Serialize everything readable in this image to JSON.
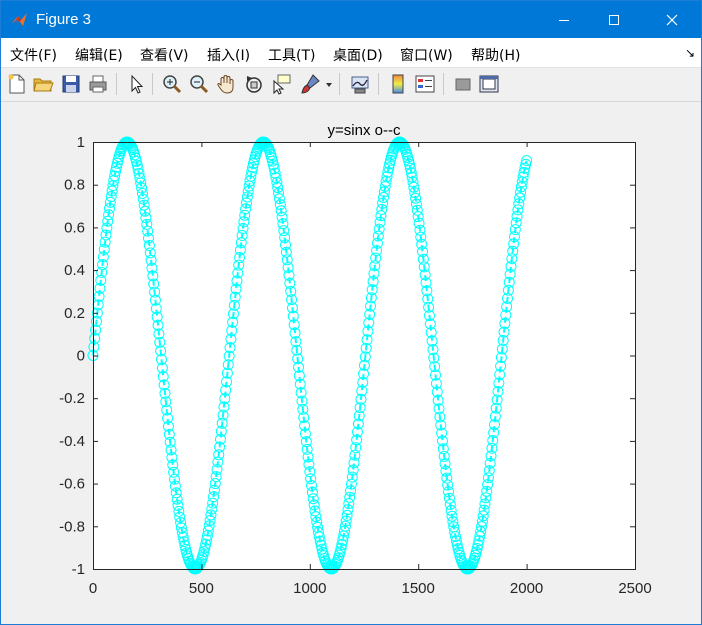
{
  "window": {
    "title": "Figure 3",
    "controls": [
      "minimize",
      "maximize",
      "close"
    ]
  },
  "menubar": {
    "items": [
      {
        "label": "文件(F)"
      },
      {
        "label": "编辑(E)"
      },
      {
        "label": "查看(V)"
      },
      {
        "label": "插入(I)"
      },
      {
        "label": "工具(T)"
      },
      {
        "label": "桌面(D)"
      },
      {
        "label": "窗口(W)"
      },
      {
        "label": "帮助(H)"
      }
    ]
  },
  "toolbar": {
    "buttons": [
      "new-figure-icon",
      "open-file-icon",
      "save-icon",
      "print-icon",
      "edit-plot-icon",
      "zoom-in-icon",
      "zoom-out-icon",
      "pan-icon",
      "rotate-3d-icon",
      "data-cursor-icon",
      "brush-icon",
      "link-plot-icon",
      "colorbar-icon",
      "legend-icon",
      "hide-plot-tools-icon",
      "show-plot-tools-icon"
    ]
  },
  "colors": {
    "titlebar": "#0078d7",
    "series": "#00ffff",
    "plot_background": "#ffffff",
    "figure_background": "#f0f0f0"
  },
  "chart_data": {
    "type": "line",
    "title": "y=sinx o--c",
    "xlabel": "",
    "ylabel": "",
    "xlim": [
      0,
      2500
    ],
    "ylim": [
      -1,
      1
    ],
    "x_ticks": [
      "0",
      "500",
      "1000",
      "1500",
      "2000",
      "2500"
    ],
    "y_ticks": [
      "-1",
      "-0.8",
      "-0.6",
      "-0.4",
      "-0.2",
      "0",
      "0.2",
      "0.4",
      "0.6",
      "0.8",
      "1"
    ],
    "grid": false,
    "marker": "o",
    "line_style": "--",
    "series": [
      {
        "x_start": 0,
        "x_end": 2000,
        "function": "y = sin(x / 100)",
        "color": "#00ffff"
      }
    ]
  }
}
